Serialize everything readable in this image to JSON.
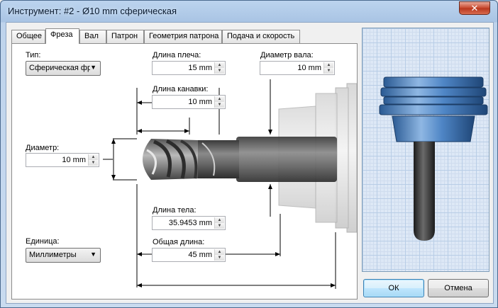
{
  "window": {
    "title": "Инструмент: #2 - Ø10 mm сферическая",
    "close_glyph": "✕"
  },
  "tabs": [
    {
      "label": "Общее",
      "active": false
    },
    {
      "label": "Фреза",
      "active": true
    },
    {
      "label": "Вал",
      "active": false
    },
    {
      "label": "Патрон",
      "active": false
    },
    {
      "label": "Геометрия патрона",
      "active": false
    },
    {
      "label": "Подача и скорость",
      "active": false
    }
  ],
  "form": {
    "type_label": "Тип:",
    "type_value": "Сферическая фр",
    "diameter_label": "Диаметр:",
    "diameter_value": "10 mm",
    "unit_label": "Единица:",
    "unit_value": "Миллиметры",
    "shoulder_label": "Длина плеча:",
    "shoulder_value": "15 mm",
    "flute_label": "Длина канавки:",
    "flute_value": "10 mm",
    "shaft_label": "Диаметр вала:",
    "shaft_value": "10 mm",
    "body_label": "Длина тела:",
    "body_value": "35.9453 mm",
    "overall_label": "Общая длина:",
    "overall_value": "45 mm"
  },
  "icons": {
    "spin_up": "▲",
    "spin_down": "▼",
    "combo_arrow": "▼"
  },
  "buttons": {
    "ok": "ОК",
    "cancel": "Отмена"
  },
  "colors": {
    "accent": "#3c7fb1",
    "holder_blue": "#4f86c6",
    "tool_dark": "#444444"
  }
}
